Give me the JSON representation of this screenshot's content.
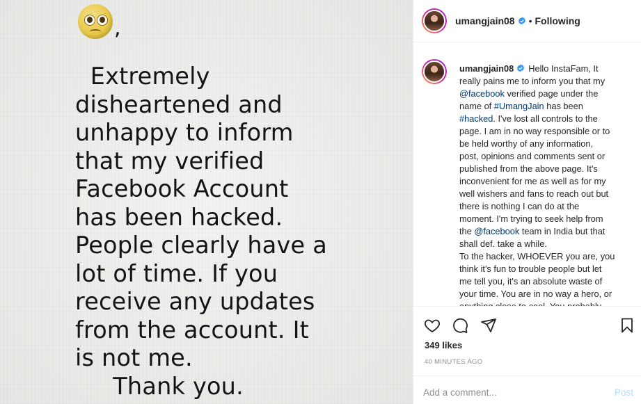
{
  "image": {
    "emoji": "pleading-face",
    "comma": ",",
    "lines": [
      "  Extremely",
      "disheartened and",
      "unhappy to inform",
      "that my verified",
      "Facebook Account",
      "has been hacked.",
      "People clearly have a",
      "lot of time. If you",
      "receive any updates",
      "from the account. It",
      "is not me.",
      "     Thank you."
    ]
  },
  "header": {
    "username": "umangjain08",
    "separator": "•",
    "follow_status": "Following"
  },
  "caption": {
    "username": "umangjain08",
    "lines": [
      {
        "parts": [
          {
            "t": "Hello InstaFam, It"
          }
        ]
      },
      {
        "parts": [
          {
            "t": "really pains me to inform you that my"
          }
        ]
      },
      {
        "parts": [
          {
            "t": "@facebook",
            "link": true
          },
          {
            "t": " verified page under the"
          }
        ]
      },
      {
        "parts": [
          {
            "t": "name of "
          },
          {
            "t": "#UmangJain",
            "link": true
          },
          {
            "t": " has been"
          }
        ]
      },
      {
        "parts": [
          {
            "t": "#hacked",
            "link": true
          },
          {
            "t": ". I've lost all controls to the"
          }
        ]
      },
      {
        "parts": [
          {
            "t": "page. I am in no way responsible or to"
          }
        ]
      },
      {
        "parts": [
          {
            "t": "be held worthy of any information,"
          }
        ]
      },
      {
        "parts": [
          {
            "t": "post, opinions and comments sent or"
          }
        ]
      },
      {
        "parts": [
          {
            "t": "published from the above page. It's"
          }
        ]
      },
      {
        "parts": [
          {
            "t": "inconvenient for me as well as for my"
          }
        ]
      },
      {
        "parts": [
          {
            "t": "well wishers and fans to reach out but"
          }
        ]
      },
      {
        "parts": [
          {
            "t": "there is nothing I can do at the"
          }
        ]
      },
      {
        "parts": [
          {
            "t": "moment. I'm trying to seek help from"
          }
        ]
      },
      {
        "parts": [
          {
            "t": "the "
          },
          {
            "t": "@facebook",
            "link": true
          },
          {
            "t": " team in India but that"
          }
        ]
      },
      {
        "parts": [
          {
            "t": "shall def. take a while."
          }
        ]
      },
      {
        "parts": [
          {
            "t": "To the hacker, WHOEVER you are, you"
          }
        ]
      },
      {
        "parts": [
          {
            "t": "think it's fun to trouble people but let"
          }
        ]
      },
      {
        "parts": [
          {
            "t": "me tell you, it's an absolute waste of"
          }
        ]
      },
      {
        "parts": [
          {
            "t": "your time. You are in no way a hero, or"
          }
        ]
      },
      {
        "parts": [
          {
            "t": "anything close to cool. You probably"
          }
        ]
      }
    ]
  },
  "actions": {
    "like_icon": "heart-icon",
    "comment_icon": "comment-icon",
    "share_icon": "send-icon",
    "save_icon": "bookmark-icon"
  },
  "likes": "349 likes",
  "timestamp": "40 MINUTES AGO",
  "comment": {
    "placeholder": "Add a comment...",
    "post_label": "Post"
  },
  "colors": {
    "link": "#00376b",
    "verified": "#3897f0",
    "post_disabled": "#b2dffc",
    "muted": "#8e8e8e"
  }
}
